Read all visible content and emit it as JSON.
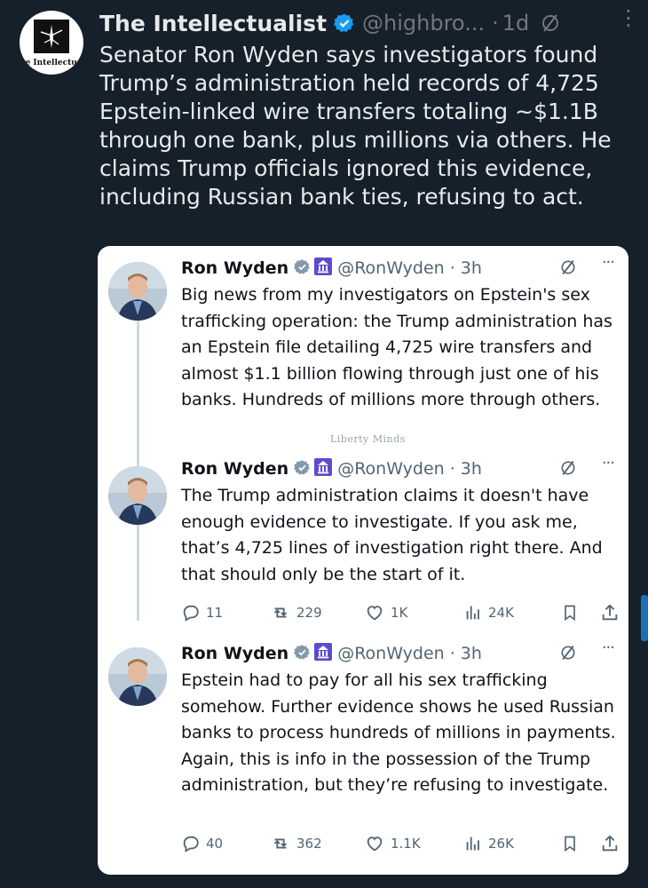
{
  "post": {
    "author_name": "The Intellectualist",
    "handle": "@highbro...",
    "separator": "·",
    "time": "1d",
    "more_label": "⋮",
    "avatar_text": "he Intellectualist",
    "text": "Senator Ron Wyden says investigators found Trump’s administration held records of 4,725 Epstein-linked wire transfers totaling ~$1.1B through one bank, plus millions via others. He claims Trump officials ignored this evidence, including Russian bank ties, refusing to act."
  },
  "quoted": {
    "watermark": "Liberty Minds",
    "tweets": [
      {
        "name": "Ron Wyden",
        "handle_time": "@RonWyden · 3h",
        "text": "Big news from my investigators on Epstein's sex trafficking operation: the Trump administration has an Epstein file detailing 4,725 wire transfers and almost $1.1 billion flowing through just one of his banks. Hundreds of millions more through others."
      },
      {
        "name": "Ron Wyden",
        "handle_time": "@RonWyden · 3h",
        "text": "The Trump administration claims it doesn't have enough evidence to investigate. If you ask me, that’s 4,725 lines of investigation right there. And that should only be the start of it.",
        "metrics": {
          "replies": "11",
          "reposts": "229",
          "likes": "1K",
          "views": "24K"
        }
      },
      {
        "name": "Ron Wyden",
        "handle_time": "@RonWyden · 3h",
        "text": "Epstein had to pay for all his sex trafficking somehow. Further evidence shows he used Russian banks to process hundreds of millions in payments. Again, this is info in the possession of the Trump administration, but they’re refusing to investigate.",
        "metrics": {
          "replies": "40",
          "reposts": "362",
          "likes": "1.1K",
          "views": "26K"
        }
      }
    ]
  },
  "colors": {
    "background": "#15202b",
    "verified": "#1d9bf0",
    "gov_badge": "#5b4ccf",
    "gray_badge": "#829aab"
  }
}
